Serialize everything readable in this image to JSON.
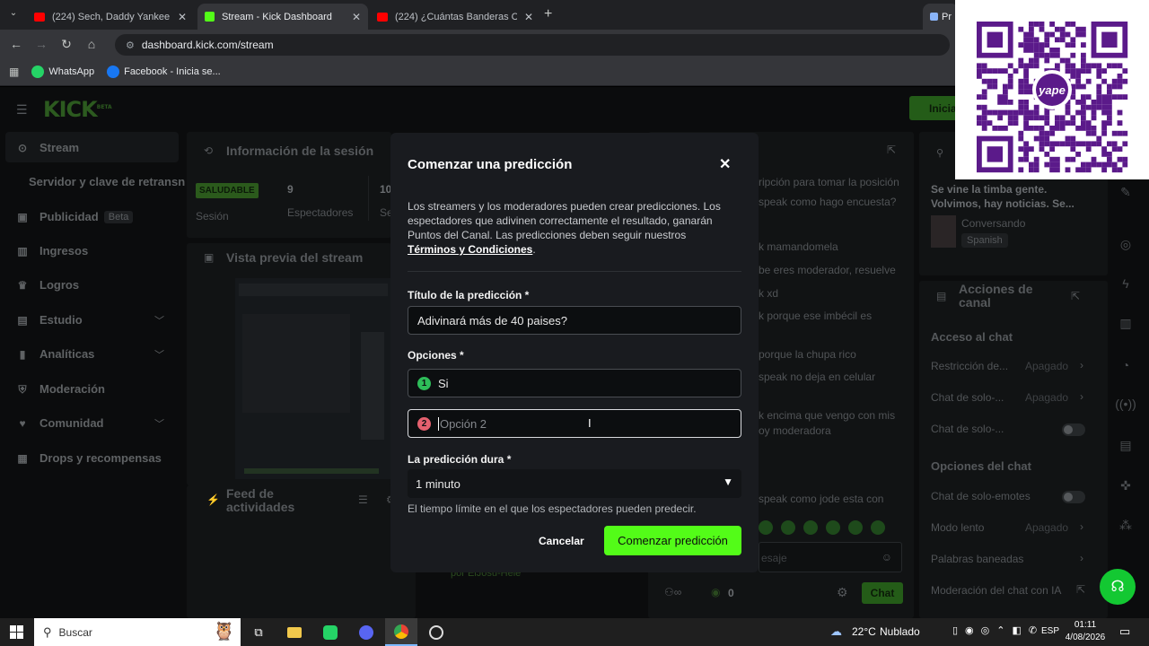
{
  "browser": {
    "tabs": [
      {
        "title": "(224) Sech, Daddy Yankee, J Bal",
        "icon": "youtube-icon",
        "color": "#ff0000"
      },
      {
        "title": "Stream - Kick Dashboard",
        "icon": "kick-icon",
        "color": "#53fc18"
      },
      {
        "title": "(224) ¿Cuántas Banderas Conoc",
        "icon": "youtube-icon",
        "color": "#ff0000"
      },
      {
        "title": "Pre",
        "icon": "chrome-icon",
        "color": "#8ab4f8"
      }
    ],
    "url": "dashboard.kick.com/stream",
    "bookmarks": [
      {
        "label": "WhatsApp",
        "icon": "whatsapp-icon",
        "color": "#25d366"
      },
      {
        "label": "Facebook - Inicia se...",
        "icon": "facebook-icon",
        "color": "#1877f2"
      }
    ]
  },
  "app": {
    "logo": "KICK",
    "logo_sup": "BETA",
    "top_button": "Inicia",
    "accent": "#53fc18"
  },
  "sidebar": {
    "items": [
      {
        "label": "Stream",
        "icon": "stream-icon",
        "active": true
      },
      {
        "label": "Servidor y clave de retransn",
        "sub": true
      },
      {
        "label": "Publicidad",
        "icon": "ads-icon",
        "badge": "Beta"
      },
      {
        "label": "Ingresos",
        "icon": "revenue-icon"
      },
      {
        "label": "Logros",
        "icon": "trophy-icon"
      },
      {
        "label": "Estudio",
        "icon": "studio-icon",
        "chevron": true
      },
      {
        "label": "Analíticas",
        "icon": "analytics-icon",
        "chevron": true
      },
      {
        "label": "Moderación",
        "icon": "shield-icon"
      },
      {
        "label": "Comunidad",
        "icon": "community-icon",
        "chevron": true
      },
      {
        "label": "Drops y recompensas",
        "icon": "gift-icon"
      }
    ]
  },
  "session": {
    "title": "Información de la sesión",
    "status_badge": "SALUDABLE",
    "status_label": "Sesión",
    "viewers": "9",
    "viewers_label": "Espectadores",
    "followers_partial": "10",
    "followers_label_partial": "Se"
  },
  "preview": {
    "title": "Vista previa del stream"
  },
  "activity": {
    "title": "Feed de actividades",
    "footer_partial": "por ElJosu-Hele"
  },
  "chat": {
    "lines": [
      "ripción para tomar la posición",
      "speak como hago encuesta?",
      "k mamandomela",
      "be eres moderador, resuelve",
      "k xd",
      "k porque ese imbécil es",
      "porque la chupa rico",
      "speak no deja en celular",
      "k encima que vengo con mis",
      "oy moderadora",
      "speak como jode esta con"
    ],
    "input_placeholder": "esaje",
    "points": "0",
    "send_button": "Chat"
  },
  "channel_info": {
    "line1": "Se vine la timba gente.",
    "line2": "Volvimos, hay noticias. Se...",
    "category": "Conversando",
    "language": "Spanish"
  },
  "channel_actions": {
    "title": "Acciones de canal",
    "chat_access": "Acceso al chat",
    "rows": [
      {
        "label": "Restricción de...",
        "value": "Apagado"
      },
      {
        "label": "Chat de solo-...",
        "value": "Apagado"
      },
      {
        "label": "Chat de solo-...",
        "toggle": true
      }
    ],
    "chat_options": "Opciones del chat",
    "rows2": [
      {
        "label": "Chat de solo-emotes",
        "toggle": true
      },
      {
        "label": "Modo lento",
        "value": "Apagado"
      },
      {
        "label": "Palabras baneadas"
      },
      {
        "label": "Moderación del chat con IA"
      }
    ]
  },
  "modal": {
    "title": "Comenzar una predicción",
    "description": "Los streamers y los moderadores pueden crear predicciones. Los espectadores que adivinen correctamente el resultado, ganarán Puntos del Canal. Las predicciones deben seguir nuestros",
    "terms_link": "Términos y Condiciones",
    "terms_suffix": ".",
    "title_label": "Título de la predicción *",
    "title_value": "Adivinará más de 40 paises?",
    "options_label": "Opciones *",
    "option1_num": "1",
    "option1_value": "Si",
    "option1_color": "#2ebd59",
    "option2_num": "2",
    "option2_placeholder": "Opción 2",
    "option2_color": "#e5616f",
    "duration_label": "La predicción dura *",
    "duration_value": "1 minuto",
    "duration_help": "El tiempo límite en el que los espectadores pueden predecir.",
    "cancel": "Cancelar",
    "submit": "Comenzar predicción"
  },
  "qr": {
    "brand": "yape",
    "color": "#5b1a8a"
  },
  "taskbar": {
    "search_placeholder": "Buscar",
    "temperature": "22°C",
    "weather": "Nublado",
    "language": "ESP",
    "time": "01:11",
    "date": "4/08/2026"
  }
}
